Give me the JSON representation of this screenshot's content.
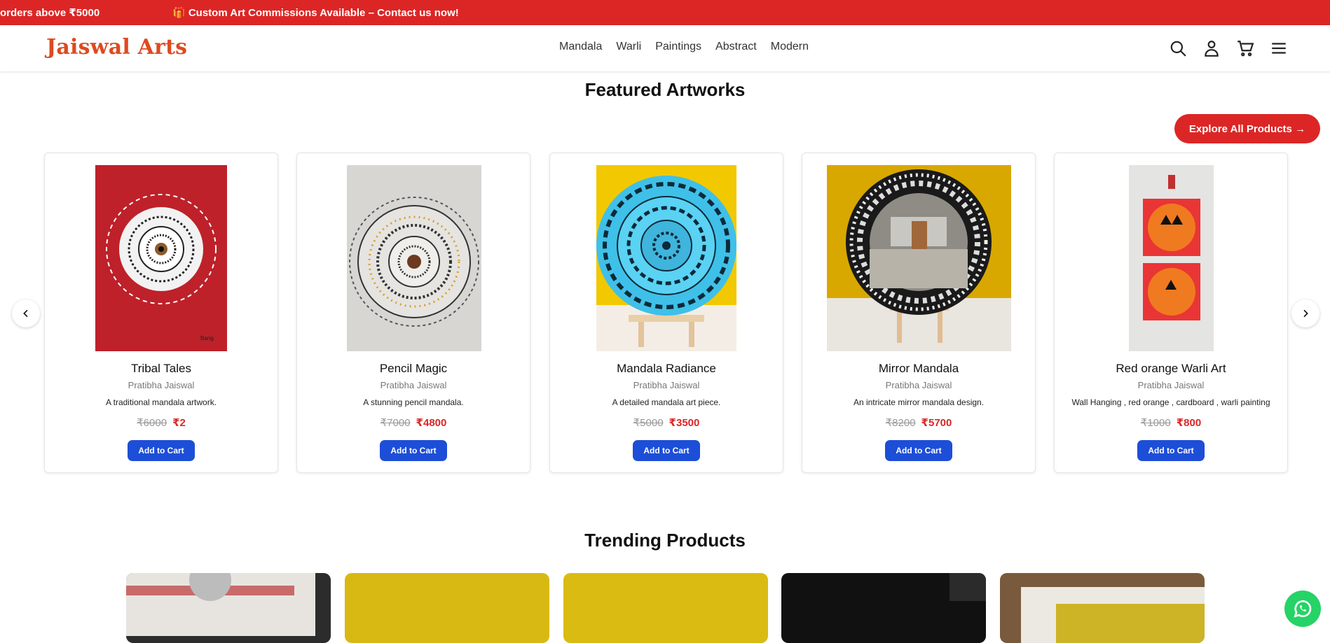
{
  "announcement": {
    "text_left": "orders above ₹5000",
    "text_right": "🎁 Custom Art Commissions Available – Contact us now!"
  },
  "header": {
    "logo": "Jaiswal Arts",
    "nav": [
      "Mandala",
      "Warli",
      "Paintings",
      "Abstract",
      "Modern"
    ],
    "icons": [
      "search-icon",
      "user-icon",
      "cart-icon",
      "menu-icon"
    ]
  },
  "featured": {
    "title": "Featured Artworks",
    "explore_label": "Explore All Products →",
    "products": [
      {
        "name": "Tribal Tales",
        "artist": "Pratibha Jaiswal",
        "desc": "A traditional mandala artwork.",
        "old_price": "₹6000",
        "new_price": "₹2",
        "button": "Add to Cart"
      },
      {
        "name": "Pencil Magic",
        "artist": "Pratibha Jaiswal",
        "desc": "A stunning pencil mandala.",
        "old_price": "₹7000",
        "new_price": "₹4800",
        "button": "Add to Cart"
      },
      {
        "name": "Mandala Radiance",
        "artist": "Pratibha Jaiswal",
        "desc": "A detailed mandala art piece.",
        "old_price": "₹5000",
        "new_price": "₹3500",
        "button": "Add to Cart"
      },
      {
        "name": "Mirror Mandala",
        "artist": "Pratibha Jaiswal",
        "desc": "An intricate mirror mandala design.",
        "old_price": "₹8200",
        "new_price": "₹5700",
        "button": "Add to Cart"
      },
      {
        "name": "Red orange Warli Art",
        "artist": "Pratibha Jaiswal",
        "desc": "Wall Hanging , red orange , cardboard , warli painting",
        "old_price": "₹1000",
        "new_price": "₹800",
        "button": "Add to Cart"
      }
    ]
  },
  "trending": {
    "title": "Trending Products"
  },
  "colors": {
    "accent_red": "#dc2626",
    "button_blue": "#1d4ed8",
    "whatsapp_green": "#25d366"
  }
}
